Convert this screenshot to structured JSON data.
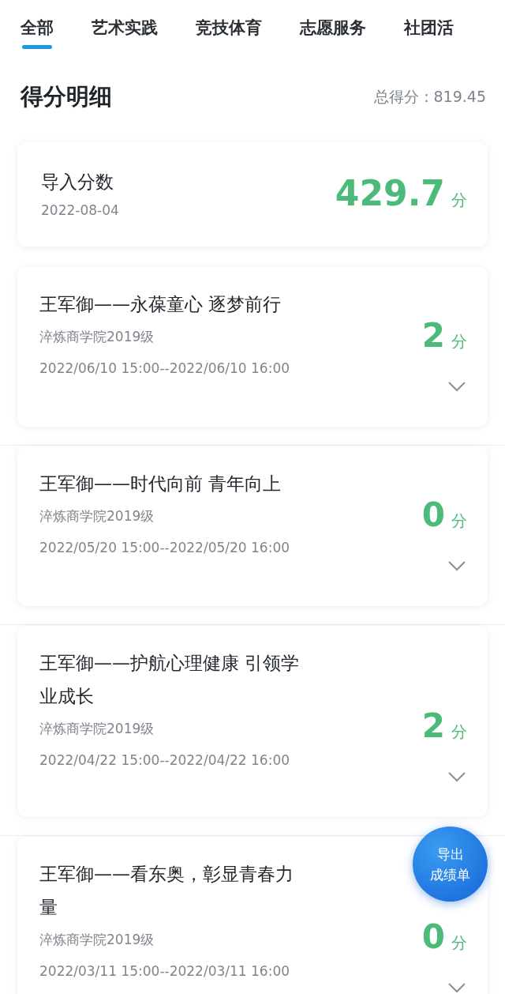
{
  "tabs": [
    {
      "label": "全部",
      "selected": true
    },
    {
      "label": "艺术实践",
      "selected": false
    },
    {
      "label": "竞技体育",
      "selected": false
    },
    {
      "label": "志愿服务",
      "selected": false
    },
    {
      "label": "社团活",
      "selected": false
    }
  ],
  "header": {
    "title": "得分明细",
    "total": "总得分：819.45"
  },
  "import_card": {
    "title": "导入分数",
    "date": "2022-08-04",
    "score": "429.7",
    "unit": "分"
  },
  "activities": [
    {
      "title": "王军御——永葆童心 逐梦前行",
      "org": "淬炼商学院2019级",
      "time": "2022/06/10 15:00--2022/06/10 16:00",
      "score": "2",
      "unit": "分",
      "expanded": false
    },
    {
      "title": "王军御——时代向前 青年向上",
      "org": "淬炼商学院2019级",
      "time": "2022/05/20 15:00--2022/05/20 16:00",
      "score": "0",
      "unit": "分",
      "expanded": false
    },
    {
      "title": "王军御——护航心理健康 引领学业成长",
      "org": "淬炼商学院2019级",
      "time": "2022/04/22 15:00--2022/04/22 16:00",
      "score": "2",
      "unit": "分",
      "expanded": false
    },
    {
      "title": "王军御——看东奥，彰显青春力量",
      "org": "淬炼商学院2019级",
      "time": "2022/03/11 15:00--2022/03/11 16:00",
      "score": "0",
      "unit": "分",
      "expanded": false
    }
  ],
  "export_button": {
    "label_lines": [
      "导出",
      "成绩单"
    ]
  }
}
